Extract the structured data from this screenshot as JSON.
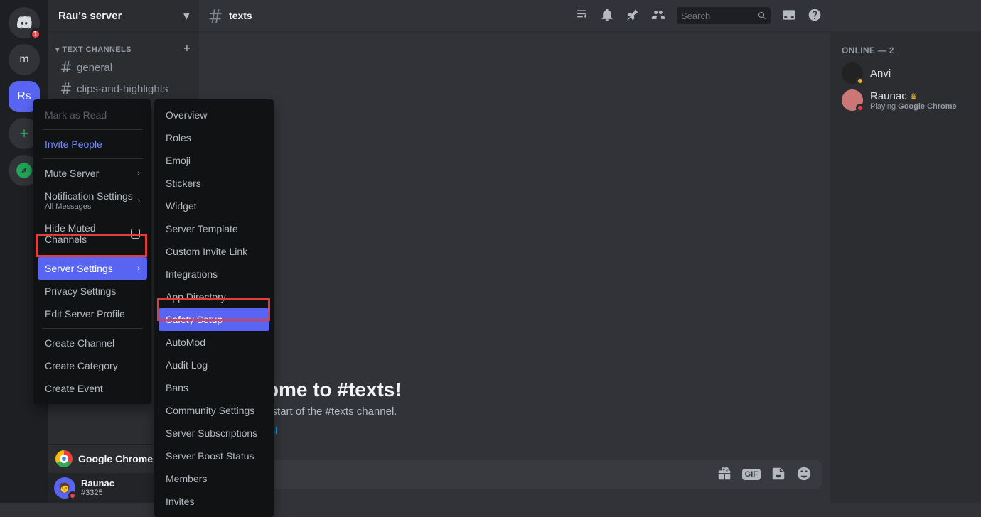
{
  "server_col": {
    "discord_badge": "1",
    "icons": [
      {
        "label": "m"
      },
      {
        "label": "Rs",
        "active": true
      }
    ]
  },
  "sidebar": {
    "server_name": "Rau's server",
    "category": "TEXT CHANNELS",
    "channels": [
      {
        "name": "general"
      },
      {
        "name": "clips-and-highlights"
      }
    ],
    "activity": "Google Chrome",
    "user": {
      "name": "Raunac",
      "tag": "#3325"
    }
  },
  "topbar": {
    "channel": "texts",
    "search_placeholder": "Search"
  },
  "welcome": {
    "title": "Welcome to #texts!",
    "subtitle": "This is the start of the #texts channel.",
    "link": "Edit Channel"
  },
  "members": {
    "section": "ONLINE — 2",
    "list": [
      {
        "name": "Anvi",
        "status": "idle"
      },
      {
        "name": "Raunac",
        "status": "dnd",
        "crown": true,
        "playing_prefix": "Playing ",
        "playing": "Google Chrome"
      }
    ]
  },
  "ctx1": {
    "mark_as_read": "Mark as Read",
    "invite": "Invite People",
    "mute": "Mute Server",
    "notif": "Notification Settings",
    "notif_sub": "All Messages",
    "hide_muted": "Hide Muted Channels",
    "server_settings": "Server Settings",
    "privacy": "Privacy Settings",
    "edit_profile": "Edit Server Profile",
    "create_channel": "Create Channel",
    "create_category": "Create Category",
    "create_event": "Create Event"
  },
  "ctx2": {
    "items": [
      "Overview",
      "Roles",
      "Emoji",
      "Stickers",
      "Widget",
      "Server Template",
      "Custom Invite Link",
      "Integrations",
      "App Directory",
      "Safety Setup",
      "AutoMod",
      "Audit Log",
      "Bans",
      "Community Settings",
      "Server Subscriptions",
      "Server Boost Status",
      "Members",
      "Invites"
    ],
    "highlight_index": 9
  },
  "chat_icons": {
    "gif": "GIF"
  }
}
